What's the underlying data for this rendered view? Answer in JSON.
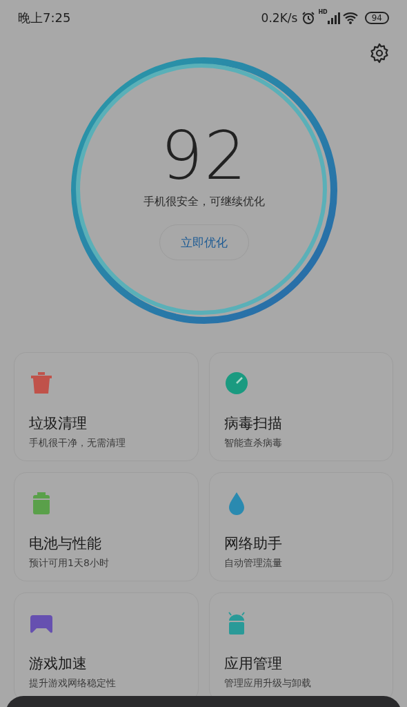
{
  "status_bar": {
    "time": "晚上7:25",
    "net_speed": "0.2K/s",
    "signal_label": "HD",
    "battery": "94"
  },
  "score": {
    "value": "92",
    "message": "手机很安全，可继续优化",
    "button": "立即优化"
  },
  "cards": [
    {
      "kind": "trash",
      "title": "垃圾清理",
      "subtitle": "手机很干净，无需清理"
    },
    {
      "kind": "virus",
      "title": "病毒扫描",
      "subtitle": "智能查杀病毒"
    },
    {
      "kind": "battery",
      "title": "电池与性能",
      "subtitle": "预计可用1天8小时"
    },
    {
      "kind": "network",
      "title": "网络助手",
      "subtitle": "自动管理流量"
    },
    {
      "kind": "game",
      "title": "游戏加速",
      "subtitle": "提升游戏网络稳定性"
    },
    {
      "kind": "apps",
      "title": "应用管理",
      "subtitle": "管理应用升级与卸载"
    }
  ]
}
